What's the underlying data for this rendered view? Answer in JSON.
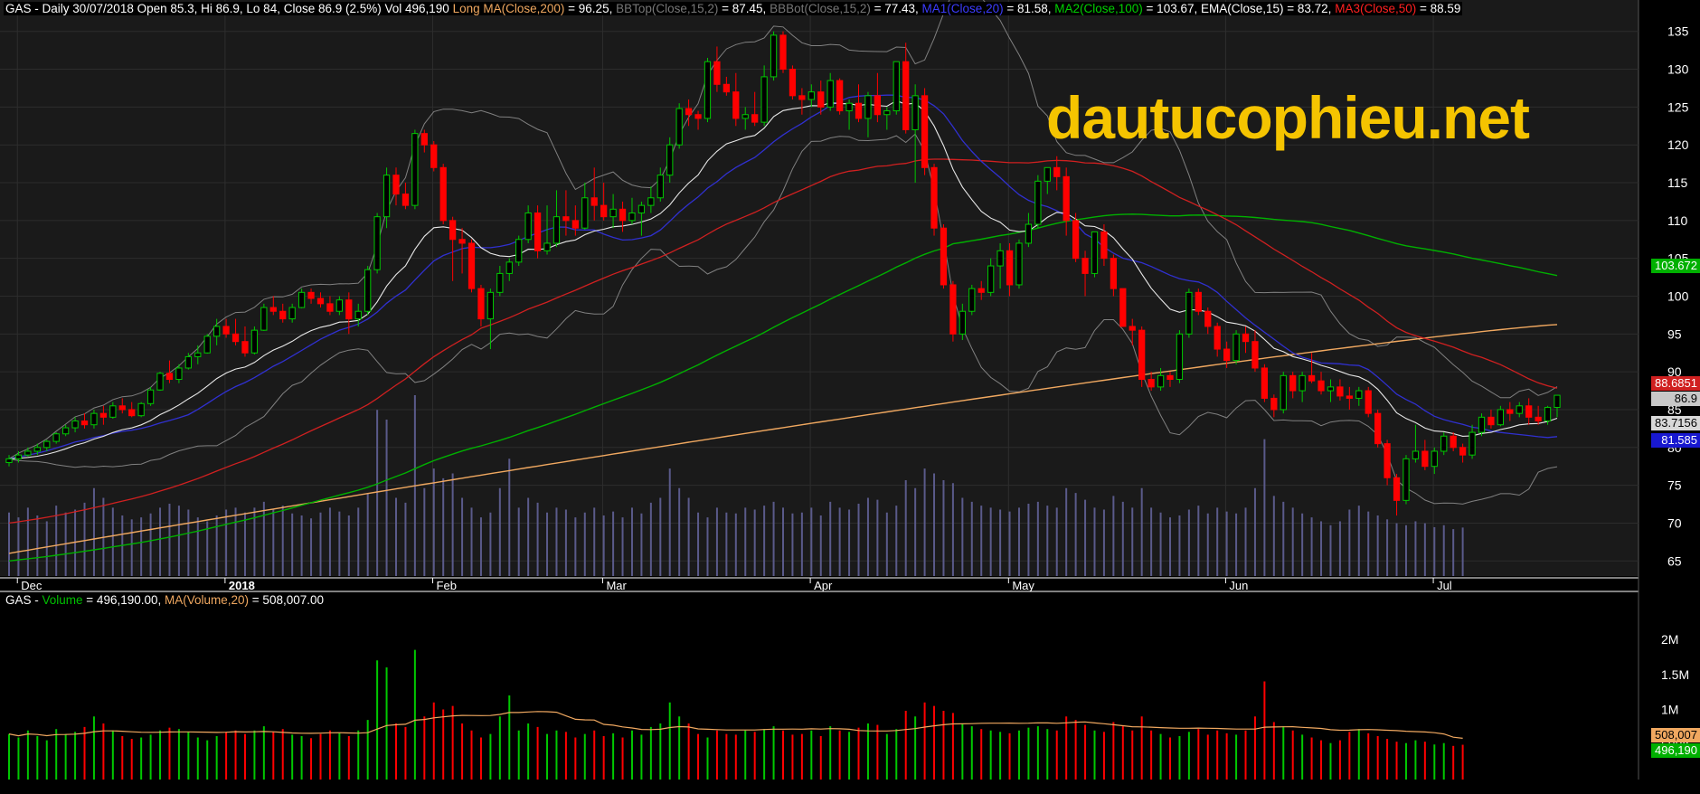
{
  "header": {
    "symbol": "GAS",
    "summary": " - Daily 30/07/2018 Open 85.3, Hi 86.9, Lo 84, Close 86.9 (2.5%) Vol 496,190 ",
    "ind_long_ma": "Long MA(Close,200)",
    "ind_long_ma_val": " = 96.25, ",
    "ind_bbtop": "BBTop(Close,15,2)",
    "ind_bbtop_val": " = 87.45, ",
    "ind_bbbot": "BBBot(Close,15,2)",
    "ind_bbbot_val": " = 77.43, ",
    "ind_ma1": "MA1(Close,20)",
    "ind_ma1_val": " = 81.58, ",
    "ind_ma2": "MA2(Close,100)",
    "ind_ma2_val": " = 103.67, ",
    "ind_ema": "EMA(Close,15)",
    "ind_ema_val": " = 83.72, ",
    "ind_ma3": "MA3(Close,50)",
    "ind_ma3_val": " = 88.59"
  },
  "volume_header": {
    "symbol": "GAS",
    "sep1": " - ",
    "volume": "Volume",
    "volume_val": " = 496,190.00, ",
    "ma": "MA(Volume,20)",
    "ma_val": " = 508,007.00"
  },
  "watermark": "dautucophieu.net",
  "value_tags": {
    "ma2": "103.672",
    "ma3": "88.6851",
    "close": "86.9",
    "ema": "83.7156",
    "ma1": "81.585",
    "vol_ma": "508,007",
    "vol": "496,190"
  },
  "colors": {
    "up": "#00c800",
    "down": "#ff0000",
    "ema": "#e8e8e8",
    "ma1": "#3030d0",
    "ma2": "#00b000",
    "ma3": "#d02020",
    "long_ma": "#f0a860",
    "bb": "#808080",
    "vol_bar": "#5a5a8a",
    "vol_ma": "#f0a860",
    "bg": "#1a1a1a",
    "grid": "#2c2c2c",
    "watermark": "#f5c400"
  },
  "chart_data": [
    {
      "type": "candlestick",
      "title": "GAS - Daily 30/07/2018",
      "ylim": [
        63,
        137
      ],
      "y_ticks": [
        65,
        70,
        75,
        80,
        85,
        90,
        95,
        100,
        105,
        110,
        115,
        120,
        125,
        130,
        135
      ],
      "x_months": [
        {
          "label": "Dec",
          "index": 0
        },
        {
          "label": "2018",
          "index": 22
        },
        {
          "label": "Feb",
          "index": 44
        },
        {
          "label": "Mar",
          "index": 62
        },
        {
          "label": "Apr",
          "index": 84
        },
        {
          "label": "May",
          "index": 105
        },
        {
          "label": "Jun",
          "index": 128
        },
        {
          "label": "Jul",
          "index": 150
        }
      ],
      "candles": [
        [
          78,
          79,
          77.5,
          78.5
        ],
        [
          78.5,
          79.5,
          78,
          79
        ],
        [
          79,
          80,
          78.8,
          79.5
        ],
        [
          79.5,
          80.5,
          79,
          80
        ],
        [
          80,
          81,
          79.5,
          80.8
        ],
        [
          80.8,
          82,
          80.5,
          81.8
        ],
        [
          81.8,
          83,
          81.5,
          82.6
        ],
        [
          82.6,
          84,
          82,
          83.5
        ],
        [
          83.5,
          84.5,
          82.5,
          83
        ],
        [
          83,
          85,
          82.5,
          84.5
        ],
        [
          84.5,
          85.5,
          83,
          84
        ],
        [
          84,
          86,
          83.8,
          85.5
        ],
        [
          85.5,
          86.5,
          84.5,
          85
        ],
        [
          85,
          86,
          84,
          84.2
        ],
        [
          84.2,
          86,
          84,
          85.8
        ],
        [
          85.8,
          88,
          85.5,
          87.6
        ],
        [
          87.6,
          90,
          87.5,
          89.8
        ],
        [
          89.8,
          91.5,
          88.5,
          89
        ],
        [
          89,
          91,
          88.5,
          90.5
        ],
        [
          90.5,
          92.5,
          90.3,
          92
        ],
        [
          92,
          93.5,
          91,
          92.5
        ],
        [
          92.5,
          95,
          92.4,
          94.7
        ],
        [
          94.7,
          97,
          93.5,
          96
        ],
        [
          96,
          97,
          94.5,
          95
        ],
        [
          95,
          97,
          93.5,
          94
        ],
        [
          94,
          96,
          92,
          92.5
        ],
        [
          92.5,
          96,
          92.3,
          95.5
        ],
        [
          95.5,
          99,
          95.4,
          98.5
        ],
        [
          98.5,
          100,
          97.5,
          98
        ],
        [
          98,
          99,
          96.5,
          97
        ],
        [
          97,
          99,
          96.5,
          98.5
        ],
        [
          98.5,
          101,
          98.4,
          100.5
        ],
        [
          100.5,
          101,
          99,
          99.7
        ],
        [
          99.7,
          100.5,
          98.5,
          99
        ],
        [
          99,
          100,
          97.5,
          98
        ],
        [
          98,
          100,
          97.5,
          99.5
        ],
        [
          99.5,
          100.5,
          95,
          97
        ],
        [
          97,
          99,
          96,
          98
        ],
        [
          98,
          104,
          97.5,
          103.5
        ],
        [
          103.5,
          111,
          103,
          110.5
        ],
        [
          110.5,
          117,
          109,
          116
        ],
        [
          116,
          117,
          112,
          113.5
        ],
        [
          113.5,
          115,
          111.5,
          112
        ],
        [
          112,
          122,
          111.5,
          121.5
        ],
        [
          121.5,
          122,
          119,
          120
        ],
        [
          120,
          120.5,
          116.5,
          117
        ],
        [
          117,
          117.5,
          109.5,
          110
        ],
        [
          110,
          110.5,
          102,
          107.5
        ],
        [
          107.5,
          109,
          103,
          107
        ],
        [
          107,
          107.5,
          100.5,
          101
        ],
        [
          101,
          101.5,
          96,
          97
        ],
        [
          97,
          101,
          93,
          100.5
        ],
        [
          100.5,
          104,
          100,
          103
        ],
        [
          103,
          105,
          102,
          104.5
        ],
        [
          104.5,
          108,
          104,
          107.5
        ],
        [
          107.5,
          112,
          107,
          111
        ],
        [
          111,
          112,
          105,
          106
        ],
        [
          106,
          112,
          105.5,
          107
        ],
        [
          107,
          114,
          106.5,
          110.5
        ],
        [
          110.5,
          114,
          108,
          110
        ],
        [
          110,
          112,
          108,
          109
        ],
        [
          109,
          115,
          108.8,
          113
        ],
        [
          113,
          117,
          110,
          112
        ],
        [
          112,
          115,
          110,
          110.5
        ],
        [
          110.5,
          113.5,
          109,
          111.5
        ],
        [
          111.5,
          112.5,
          108.5,
          110
        ],
        [
          110,
          113,
          109.5,
          111
        ],
        [
          111,
          112.5,
          108,
          112
        ],
        [
          112,
          114.5,
          111,
          113
        ],
        [
          113,
          117,
          112.5,
          116
        ],
        [
          116,
          121,
          115,
          120
        ],
        [
          120,
          125.5,
          119.5,
          124.8
        ],
        [
          124.8,
          126,
          122.5,
          124
        ],
        [
          124,
          124.5,
          122,
          123.5
        ],
        [
          123.5,
          131.5,
          123,
          131
        ],
        [
          131,
          133,
          127,
          128
        ],
        [
          128,
          129,
          126.5,
          127
        ],
        [
          127,
          129.5,
          122.5,
          123.5
        ],
        [
          123.5,
          125,
          122,
          124
        ],
        [
          124,
          127,
          122.5,
          123
        ],
        [
          123,
          130.5,
          122.5,
          129
        ],
        [
          129,
          135,
          128.5,
          134.5
        ],
        [
          134.5,
          135,
          129.5,
          130
        ],
        [
          130,
          130.5,
          126,
          126.5
        ],
        [
          126.5,
          127.5,
          124,
          126
        ],
        [
          126,
          128,
          125,
          127
        ],
        [
          127,
          128.5,
          124,
          125
        ],
        [
          125,
          129.5,
          124.5,
          128.5
        ],
        [
          128.5,
          128.8,
          124,
          124.5
        ],
        [
          124.5,
          126,
          122,
          125.5
        ],
        [
          125.5,
          128,
          123,
          123.5
        ],
        [
          123.5,
          127,
          121,
          126.5
        ],
        [
          126.5,
          129.5,
          123,
          124
        ],
        [
          124,
          125,
          122,
          124.5
        ],
        [
          124.5,
          131,
          124,
          131
        ],
        [
          131,
          133.5,
          121.5,
          122
        ],
        [
          122,
          128,
          115,
          126.5
        ],
        [
          126.5,
          127.5,
          116,
          117
        ],
        [
          117,
          117.5,
          108,
          109
        ],
        [
          109,
          109.5,
          101,
          101.5
        ],
        [
          101.5,
          102,
          94,
          95
        ],
        [
          95,
          99,
          94.2,
          98
        ],
        [
          98,
          101.5,
          97.5,
          101
        ],
        [
          101,
          102,
          99.5,
          100.5
        ],
        [
          100.5,
          105,
          100,
          104
        ],
        [
          104,
          107,
          101,
          106
        ],
        [
          106,
          107,
          100,
          101.5
        ],
        [
          101.5,
          107.5,
          101,
          107
        ],
        [
          107,
          111,
          106.5,
          109.5
        ],
        [
          109.5,
          116,
          109,
          115.2
        ],
        [
          115.2,
          117,
          113.5,
          117
        ],
        [
          117,
          118.5,
          114,
          115.8
        ],
        [
          115.8,
          117,
          108,
          110
        ],
        [
          110,
          111,
          104.5,
          105
        ],
        [
          105,
          106,
          100,
          103
        ],
        [
          103,
          108.5,
          102.5,
          108.5
        ],
        [
          108.5,
          109.5,
          104,
          105
        ],
        [
          105,
          105.5,
          100,
          101
        ],
        [
          101,
          97.5,
          96,
          96
        ],
        [
          96,
          97,
          93.5,
          95.5
        ],
        [
          95.5,
          96,
          88,
          89
        ],
        [
          89,
          90,
          87.5,
          88
        ],
        [
          88,
          90.5,
          87.5,
          89.5
        ],
        [
          89.5,
          90,
          88,
          89
        ],
        [
          89,
          95.5,
          88.5,
          95
        ],
        [
          95,
          101,
          94.5,
          100.5
        ],
        [
          100.5,
          101,
          97.5,
          98
        ],
        [
          98,
          98.5,
          95,
          96
        ],
        [
          96,
          96.5,
          92,
          93
        ],
        [
          93,
          94,
          90.5,
          91.5
        ],
        [
          91.5,
          95.5,
          91,
          95
        ],
        [
          95,
          96,
          92.5,
          94
        ],
        [
          94,
          95.5,
          90,
          90.5
        ],
        [
          90.5,
          91,
          86,
          86.5
        ],
        [
          86.5,
          87,
          84,
          85
        ],
        [
          85,
          90,
          84.5,
          89.5
        ],
        [
          89.5,
          90,
          86.5,
          87.5
        ],
        [
          87.5,
          90,
          86,
          89.5
        ],
        [
          89.5,
          92.5,
          88.5,
          88.8
        ],
        [
          88.8,
          90,
          87,
          87.5
        ],
        [
          87.5,
          89,
          86,
          88
        ],
        [
          88,
          89,
          86.2,
          86.8
        ],
        [
          86.8,
          88,
          85,
          86.5
        ],
        [
          86.5,
          88,
          85.5,
          87.5
        ],
        [
          87.5,
          88,
          84,
          84.5
        ],
        [
          84.5,
          85,
          80,
          80.5
        ],
        [
          80.5,
          81,
          75,
          76
        ],
        [
          76,
          76.5,
          71,
          73
        ],
        [
          73,
          79,
          72.5,
          78.5
        ],
        [
          78.5,
          83,
          78,
          79.5
        ],
        [
          79.5,
          81,
          77,
          77.5
        ],
        [
          77.5,
          80,
          76.5,
          79.5
        ],
        [
          79.5,
          82,
          79,
          81.5
        ],
        [
          81.5,
          82,
          79.5,
          80
        ],
        [
          80,
          80.5,
          78,
          79
        ],
        [
          79,
          83,
          78.5,
          82
        ],
        [
          82,
          84.5,
          81.5,
          84
        ],
        [
          84,
          85,
          82.5,
          83
        ],
        [
          83,
          85.5,
          82.8,
          85
        ],
        [
          85,
          86,
          83.5,
          84.5
        ],
        [
          84.5,
          86,
          84,
          85.5
        ],
        [
          85.5,
          86.5,
          83,
          84
        ],
        [
          84,
          85.5,
          83,
          83.5
        ],
        [
          83.5,
          85.5,
          83,
          85.3
        ],
        [
          85.3,
          86.9,
          84,
          86.9
        ]
      ],
      "overlays": {
        "long_ma_200": {
          "start": 66,
          "end": 96.25
        },
        "ma2_100": {
          "start": 65,
          "end": 103.67
        },
        "ma3_50": {
          "start": 70,
          "end": 88.59
        },
        "ma1_20": {
          "last": 81.58
        },
        "ema_15": {
          "last": 83.72
        },
        "bbtop": {
          "last": 87.45
        },
        "bbbot": {
          "last": 77.43
        }
      }
    },
    {
      "type": "bar",
      "title": "Volume",
      "ylim": [
        0,
        2400000
      ],
      "y_ticks": [
        {
          "v": 500000,
          "label": "500K"
        },
        {
          "v": 1000000,
          "label": "1M"
        },
        {
          "v": 1500000,
          "label": "1.5M"
        },
        {
          "v": 2000000,
          "label": "2M"
        }
      ],
      "values": [
        650000,
        600000,
        700000,
        620000,
        560000,
        720000,
        650000,
        680000,
        750000,
        900000,
        800000,
        700000,
        620000,
        580000,
        600000,
        640000,
        700000,
        740000,
        720000,
        680000,
        600000,
        560000,
        620000,
        680000,
        700000,
        650000,
        700000,
        760000,
        680000,
        720000,
        640000,
        620000,
        590000,
        650000,
        700000,
        660000,
        620000,
        700000,
        850000,
        1700000,
        1600000,
        800000,
        750000,
        1850000,
        900000,
        1100000,
        1000000,
        1050000,
        800000,
        700000,
        600000,
        650000,
        900000,
        1200000,
        700000,
        800000,
        750000,
        650000,
        700000,
        680000,
        600000,
        650000,
        700000,
        620000,
        660000,
        600000,
        700000,
        640000,
        750000,
        800000,
        1100000,
        900000,
        800000,
        650000,
        600000,
        700000,
        650000,
        640000,
        700000,
        680000,
        720000,
        760000,
        700000,
        640000,
        650000,
        700000,
        620000,
        760000,
        700000,
        680000,
        740000,
        800000,
        780000,
        650000,
        720000,
        980000,
        900000,
        1100000,
        1050000,
        980000,
        950000,
        800000,
        760000,
        720000,
        700000,
        680000,
        660000,
        700000,
        740000,
        760000,
        720000,
        700000,
        900000,
        850000,
        780000,
        700000,
        680000,
        820000,
        760000,
        700000,
        900000,
        700000,
        650000,
        600000,
        620000,
        680000,
        720000,
        640000,
        700000,
        660000,
        640000,
        700000,
        900000,
        1400000,
        820000,
        760000,
        700000,
        640000,
        600000,
        560000,
        520000,
        560000,
        680000,
        720000,
        660000,
        620000,
        580000,
        540000,
        520000,
        560000,
        540000,
        500000,
        520000,
        480000,
        496190
      ]
    }
  ]
}
